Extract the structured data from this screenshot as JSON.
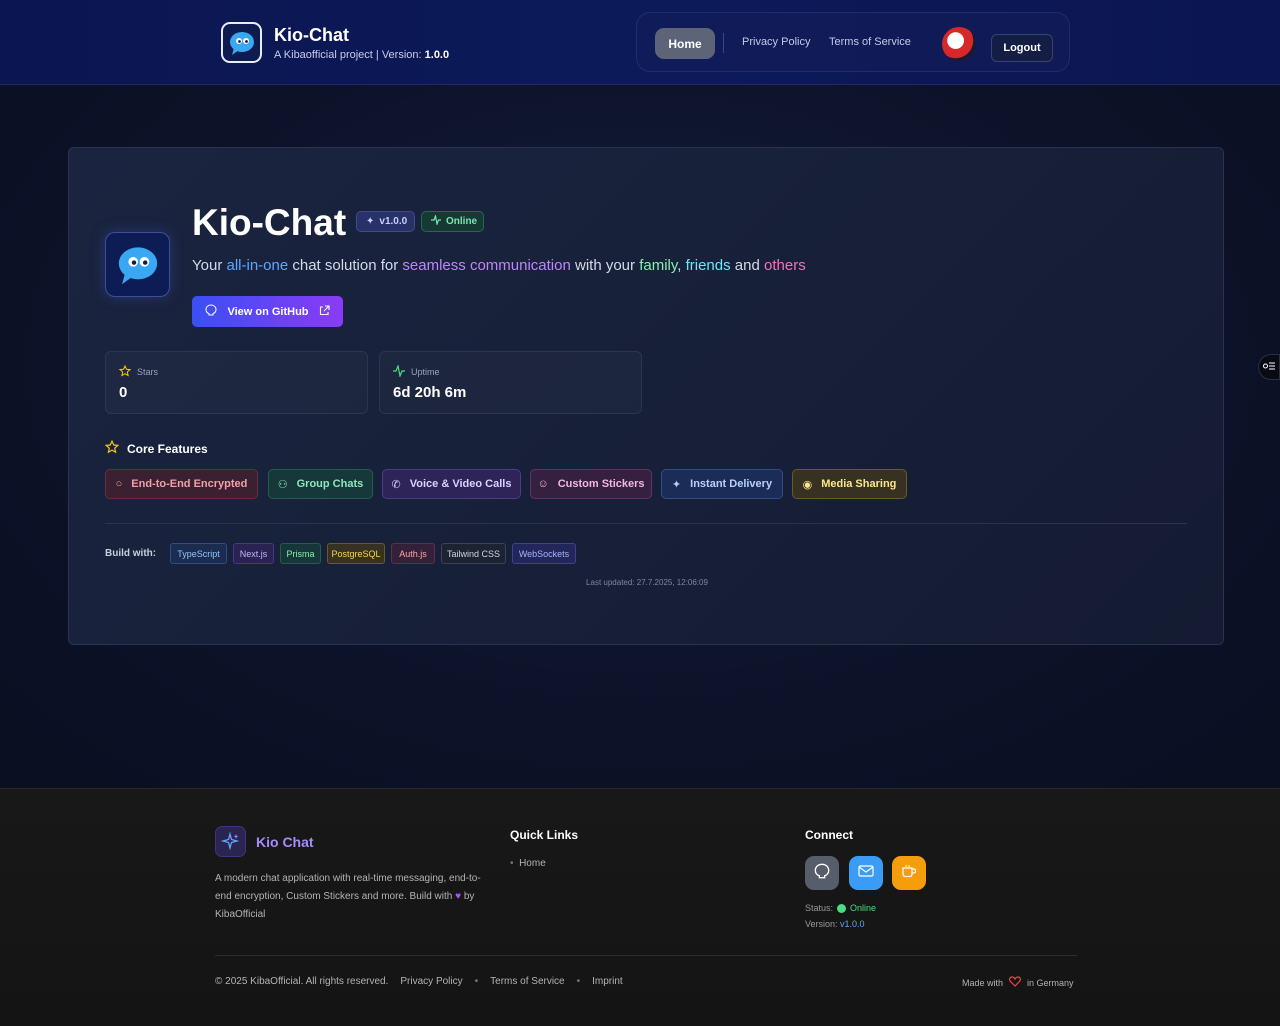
{
  "header": {
    "title": "Kio-Chat",
    "subtitle_prefix": "A Kibaofficial project | Version: ",
    "version": "1.0.0",
    "nav": {
      "home": "Home",
      "privacy": "Privacy Policy",
      "terms": "Terms of Service",
      "logout": "Logout"
    }
  },
  "hero": {
    "title": "Kio-Chat",
    "version_badge": "v1.0.0",
    "status_badge": "Online",
    "tagline": {
      "t1": "Your ",
      "h1": "all-in-one",
      "t2": " chat solution for ",
      "h2": "seamless communication",
      "t3": " with your ",
      "h3": "family",
      "t4": ", ",
      "h4": "friends",
      "t5": " and ",
      "h5": "others"
    },
    "github_button": "View on GitHub"
  },
  "stats": [
    {
      "label": "Stars",
      "value": "0",
      "icon": "star-icon"
    },
    {
      "label": "Uptime",
      "value": "6d 20h 6m",
      "icon": "activity-icon"
    }
  ],
  "features": {
    "title": "Core Features",
    "items": [
      {
        "label": "End-to-End Encrypted",
        "icon": "shield-icon"
      },
      {
        "label": "Group Chats",
        "icon": "users-icon"
      },
      {
        "label": "Voice & Video Calls",
        "icon": "phone-icon"
      },
      {
        "label": "Custom Stickers",
        "icon": "smile-icon"
      },
      {
        "label": "Instant Delivery",
        "icon": "zap-icon"
      },
      {
        "label": "Media Sharing",
        "icon": "camera-icon"
      }
    ]
  },
  "build": {
    "label": "Build with:",
    "tags": [
      "TypeScript",
      "Next.js",
      "Prisma",
      "PostgreSQL",
      "Auth.js",
      "Tailwind CSS",
      "WebSockets"
    ]
  },
  "last_updated": "Last updated: 27.7.2025, 12:06:09",
  "footer": {
    "brand": "Kio Chat",
    "description": "A modern chat application with real-time messaging, end-to-end encryption, Custom Stickers and more. Build with",
    "description_suffix": "by KibaOfficial",
    "quick_links_title": "Quick Links",
    "quick_links": [
      "Home"
    ],
    "connect_title": "Connect",
    "status_label": "Status:",
    "status_value": "Online",
    "version_label": "Version:",
    "version_value": "v1.0.0",
    "copyright": "© 2025 KibaOfficial. All rights reserved.",
    "links": [
      "Privacy Policy",
      "Terms of Service",
      "Imprint"
    ],
    "made_with_prefix": "Made with",
    "made_with_suffix": "in Germany"
  },
  "colors": {
    "accent_blue": "#3b4ff5",
    "accent_purple": "#8a3bf5",
    "online_green": "#4ade80"
  }
}
